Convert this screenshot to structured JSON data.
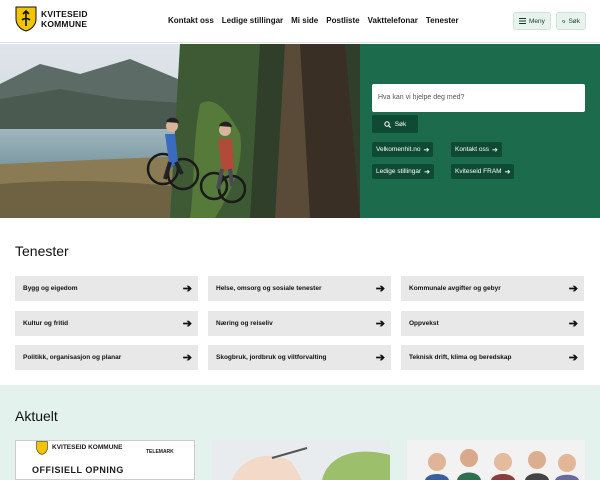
{
  "header": {
    "logo_line1": "KVITESEID",
    "logo_line2": "KOMMUNE",
    "nav": [
      "Kontakt oss",
      "Ledige stillingar",
      "Mi side",
      "Postliste",
      "Vakttelefonar",
      "Tenester"
    ],
    "menu_label": "Meny",
    "search_label": "Søk"
  },
  "hero": {
    "search_placeholder": "Hva kan vi hjelpe deg med?",
    "search_button": "Søk",
    "quick_links": [
      "Velkomenhit.no",
      "Kontakt oss",
      "Ledige stillingar",
      "Kviteseid FRAM"
    ]
  },
  "tenester": {
    "title": "Tenester",
    "items": [
      "Bygg og eigedom",
      "Helse, omsorg og sosiale tenester",
      "Kommunale avgifter og gebyr",
      "Kultur og fritid",
      "Næring og reiseliv",
      "Oppvekst",
      "Politikk, organisasjon og planar",
      "Skogbruk, jordbruk og viltforvalting",
      "Teknisk drift, klima og beredskap"
    ]
  },
  "aktuelt": {
    "title": "Aktuelt",
    "card1_logo": "KVITESEID KOMMUNE",
    "card1_sub": "TELEMARK",
    "card1_text": "OFFISIELL OPNING"
  },
  "colors": {
    "brand_green": "#1c6b4d",
    "dark_green": "#0f4a34",
    "light_green": "#e3f2ec",
    "logo_yellow": "#f2c500"
  }
}
